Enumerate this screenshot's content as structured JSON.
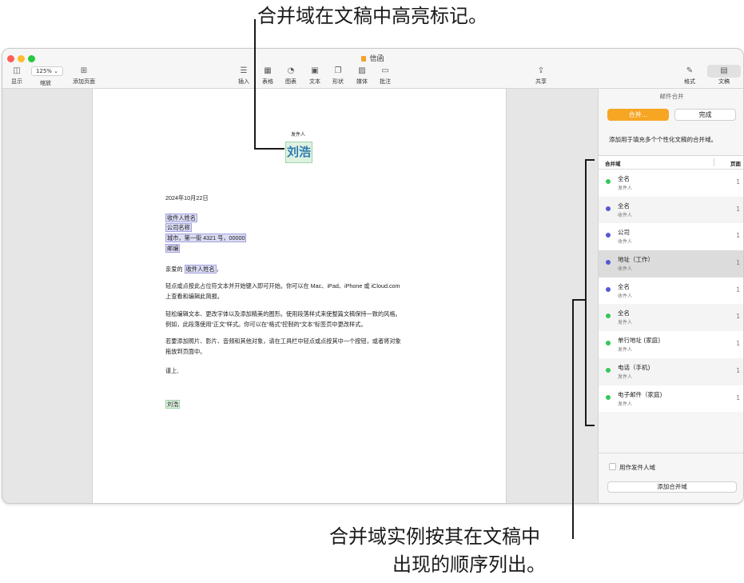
{
  "callouts": {
    "top": "合并域在文稿中高亮标记。",
    "bottom_line1": "合并域实例按其在文稿中",
    "bottom_line2": "出现的顺序列出。"
  },
  "window": {
    "title": "信函",
    "traffic_colors": [
      "#fe5f57",
      "#febc2e",
      "#28c840"
    ]
  },
  "toolbar": {
    "display": "显示",
    "zoom_value": "125% ⌄",
    "zoom": "缩放",
    "add_page": "添加页面",
    "insert": "插入",
    "table": "表格",
    "chart": "图表",
    "text": "文本",
    "shape": "形状",
    "media": "媒体",
    "comment": "批注",
    "share": "共享",
    "format": "格式",
    "document": "文稿"
  },
  "letter": {
    "sender_label": "发件人",
    "sender_name": "刘浩",
    "date": "2024年10月22日",
    "recipient_name": "收件人姓名",
    "company": "公司名称",
    "address": "城市，第一街 4321 号，00000",
    "postcode": "邮编",
    "greeting_prefix": "亲爱的 ",
    "greeting_field": "收件人姓名",
    "greeting_suffix": "，",
    "para1_line1": "轻点或点按此占位符文本并开始键入即可开始。你可以在 Mac、iPad、iPhone 或 iCloud.com",
    "para1_line2": "上查看和编辑此简报。",
    "para2_line1": "轻松编辑文本、更改字体以及添加精美的图形。使用段落样式来使整篇文稿保持一致的风格。",
    "para2_line2": "例如，此段落使用“正文”样式。你可以在“格式”控制的“文本”标签页中更改样式。",
    "para3_line1": "若要添加照片、影片、音频和其他对象，请在工具栏中轻点或点按其中一个按钮，或者将对象",
    "para3_line2": "拖放到页面中。",
    "closing": "谨上,",
    "signature": "刘浩"
  },
  "sidebar": {
    "title": "邮件合并",
    "tab_merge": "合并...",
    "tab_done": "完成",
    "description": "添加用于填充多个个性化文稿的合并域。",
    "col_field": "合并域",
    "col_page": "页面",
    "fields": [
      {
        "name": "全名",
        "sub": "发件人",
        "page": "1",
        "color": "#34c759"
      },
      {
        "name": "全名",
        "sub": "收件人",
        "page": "1",
        "color": "#5856d6"
      },
      {
        "name": "公司",
        "sub": "收件人",
        "page": "1",
        "color": "#5856d6"
      },
      {
        "name": "地址（工作）",
        "sub": "收件人",
        "page": "1",
        "color": "#5856d6"
      },
      {
        "name": "全名",
        "sub": "收件人",
        "page": "1",
        "color": "#5856d6"
      },
      {
        "name": "全名",
        "sub": "发件人",
        "page": "1",
        "color": "#34c759"
      },
      {
        "name": "单行地址 (家庭)",
        "sub": "发件人",
        "page": "1",
        "color": "#34c759"
      },
      {
        "name": "电话（手机)",
        "sub": "发件人",
        "page": "1",
        "color": "#34c759"
      },
      {
        "name": "电子邮件（家庭)",
        "sub": "发件人",
        "page": "1",
        "color": "#34c759"
      }
    ],
    "use_sender_field": "用作发件人域",
    "add_merge_field": "添加合并域"
  }
}
